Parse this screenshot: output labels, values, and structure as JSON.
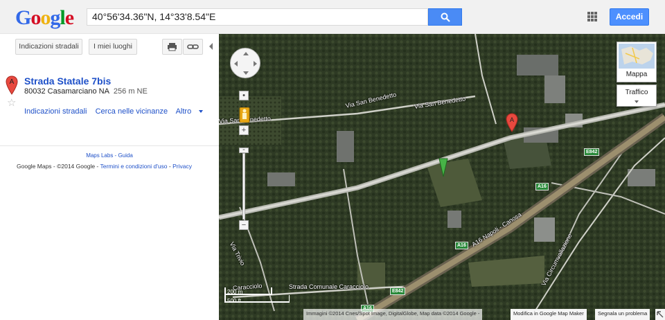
{
  "header": {
    "logo_letters": [
      {
        "ch": "G",
        "color": "#3369e8"
      },
      {
        "ch": "o",
        "color": "#d50f25"
      },
      {
        "ch": "o",
        "color": "#eeb211"
      },
      {
        "ch": "g",
        "color": "#3369e8"
      },
      {
        "ch": "l",
        "color": "#009925"
      },
      {
        "ch": "e",
        "color": "#d50f25"
      }
    ],
    "search_value": "40°56'34.36\"N, 14°33'8.54\"E",
    "signin_label": "Accedi",
    "search_btn_color": "#4a8bf5"
  },
  "toolbar": {
    "directions_label": "Indicazioni stradali",
    "my_places_label": "I miei luoghi",
    "print_icon": "print-icon",
    "link_icon": "link-icon"
  },
  "result": {
    "marker_letter": "A",
    "title": "Strada Statale 7bis",
    "address": "80032 Casamarciano NA",
    "distance": "256 m NE",
    "links": [
      "Indicazioni stradali",
      "Cerca nelle vicinanze",
      "Altro"
    ]
  },
  "footer": {
    "labs": "Maps Labs",
    "sep": " - ",
    "help": "Guida",
    "brand": "Google Maps",
    "copyright": " - ©2014 Google - ",
    "terms": "Termini e condizioni d'uso",
    "dash": " - ",
    "privacy": "Privacy"
  },
  "map": {
    "roads": {
      "san_benedetto_1": "Via San Benedetto",
      "san_benedetto_2": "Via San Benedetto",
      "san_benedetto_3": "Via San Benedetto",
      "trivio": "Via Trivio",
      "caracciolo_1": "Strada Comunale Caracciolo",
      "caracciolo_2": "Caracciolo",
      "a16": "A16 Napoli - Canosa",
      "circumvallazione": "Via Circumvallazione"
    },
    "shields": {
      "e842_a": "E842",
      "e842_b": "E842",
      "a16_a": "A16",
      "a16_b": "A16",
      "a16_c": "A16"
    },
    "marker_letter": "A",
    "maptype_label": "Mappa",
    "traffic_label": "Traffico",
    "scale_m": "200 m",
    "scale_ft": "500 ft",
    "attribution": "Immagini ©2014 Cnes/Spot Image, DigitalGlobe, Map data ©2014 Google -",
    "mapmaker": "Modifica in Google Map Maker",
    "report": "Segnala un problema"
  }
}
